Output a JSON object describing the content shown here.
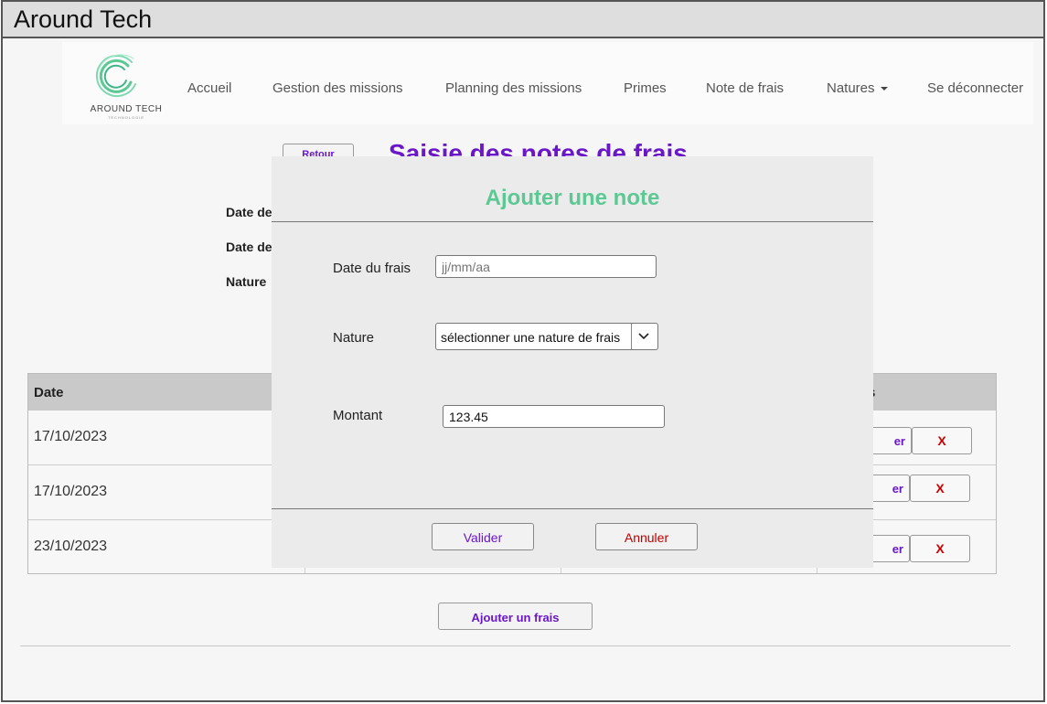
{
  "window": {
    "title": "Around Tech"
  },
  "logo": {
    "brand": "AROUND TECH",
    "sub": "TECHNOLOGIE"
  },
  "nav": {
    "items": [
      {
        "label": "Accueil"
      },
      {
        "label": "Gestion des missions"
      },
      {
        "label": "Planning des missions"
      },
      {
        "label": "Primes"
      },
      {
        "label": "Note de frais"
      },
      {
        "label": "Natures"
      },
      {
        "label": "Se déconnecter"
      }
    ],
    "natures_dropdown_icon": "caret-down-icon"
  },
  "page": {
    "back_label": "Retour",
    "title": "Saisie des notes de frais",
    "filters": [
      "Date de",
      "Date de",
      "Nature"
    ]
  },
  "table": {
    "headers": {
      "date": "Date",
      "actions": "s"
    },
    "rows": [
      {
        "date": "17/10/2023",
        "edit": "er",
        "delete": "X"
      },
      {
        "date": "17/10/2023",
        "edit": "er",
        "delete": "X"
      },
      {
        "date": "23/10/2023",
        "edit": "er",
        "delete": "X"
      }
    ]
  },
  "add_button": "Ajouter un frais",
  "modal": {
    "title": "Ajouter une note",
    "date_label": "Date du frais",
    "date_placeholder": "jj/mm/aa",
    "nature_label": "Nature",
    "nature_selected": "sélectionner une nature de frais",
    "amount_label": "Montant",
    "amount_value": "123.45",
    "validate_label": "Valider",
    "cancel_label": "Annuler"
  },
  "colors": {
    "accent_purple": "#6a17c8",
    "modal_title_green": "#5cc894",
    "delete_red": "#cc0000",
    "cancel_red": "#c00000"
  }
}
